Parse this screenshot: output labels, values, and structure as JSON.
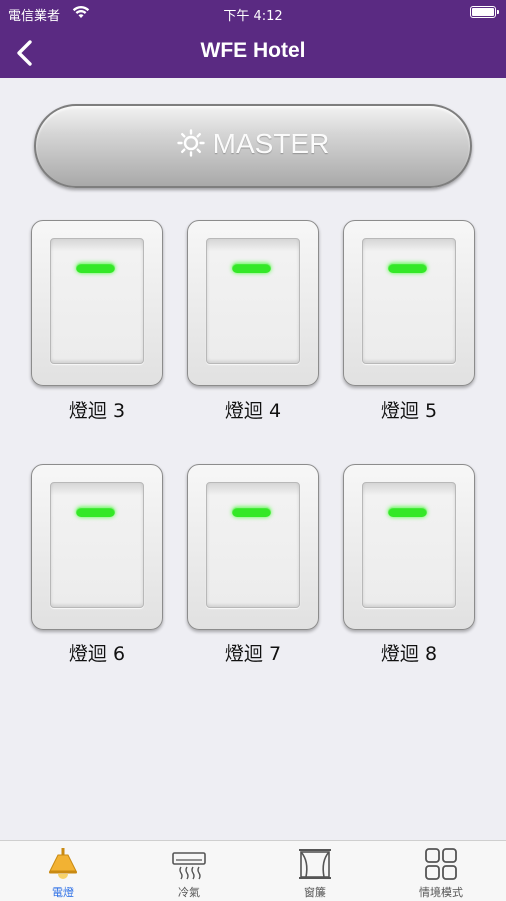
{
  "status_bar": {
    "carrier": "電信業者",
    "time": "下午 4:12"
  },
  "nav": {
    "title": "WFE Hotel",
    "back_icon": "chevron-left-icon"
  },
  "master": {
    "label": "MASTER",
    "icon": "sun-icon"
  },
  "switches": [
    {
      "label": "燈迴 3",
      "led_color": "#34e827"
    },
    {
      "label": "燈迴 4",
      "led_color": "#34e827"
    },
    {
      "label": "燈迴 5",
      "led_color": "#34e827"
    },
    {
      "label": "燈迴 6",
      "led_color": "#34e827"
    },
    {
      "label": "燈迴 7",
      "led_color": "#34e827"
    },
    {
      "label": "燈迴 8",
      "led_color": "#34e827"
    }
  ],
  "tabs": [
    {
      "label": "電燈",
      "icon": "lamp-icon",
      "active": true
    },
    {
      "label": "冷氣",
      "icon": "air-conditioner-icon",
      "active": false
    },
    {
      "label": "窗簾",
      "icon": "curtain-icon",
      "active": false
    },
    {
      "label": "情境模式",
      "icon": "grid-icon",
      "active": false
    }
  ],
  "colors": {
    "header": "#5a2a82",
    "accent": "#2a6ee6",
    "led": "#34e827",
    "lamp": "#f2b233"
  }
}
